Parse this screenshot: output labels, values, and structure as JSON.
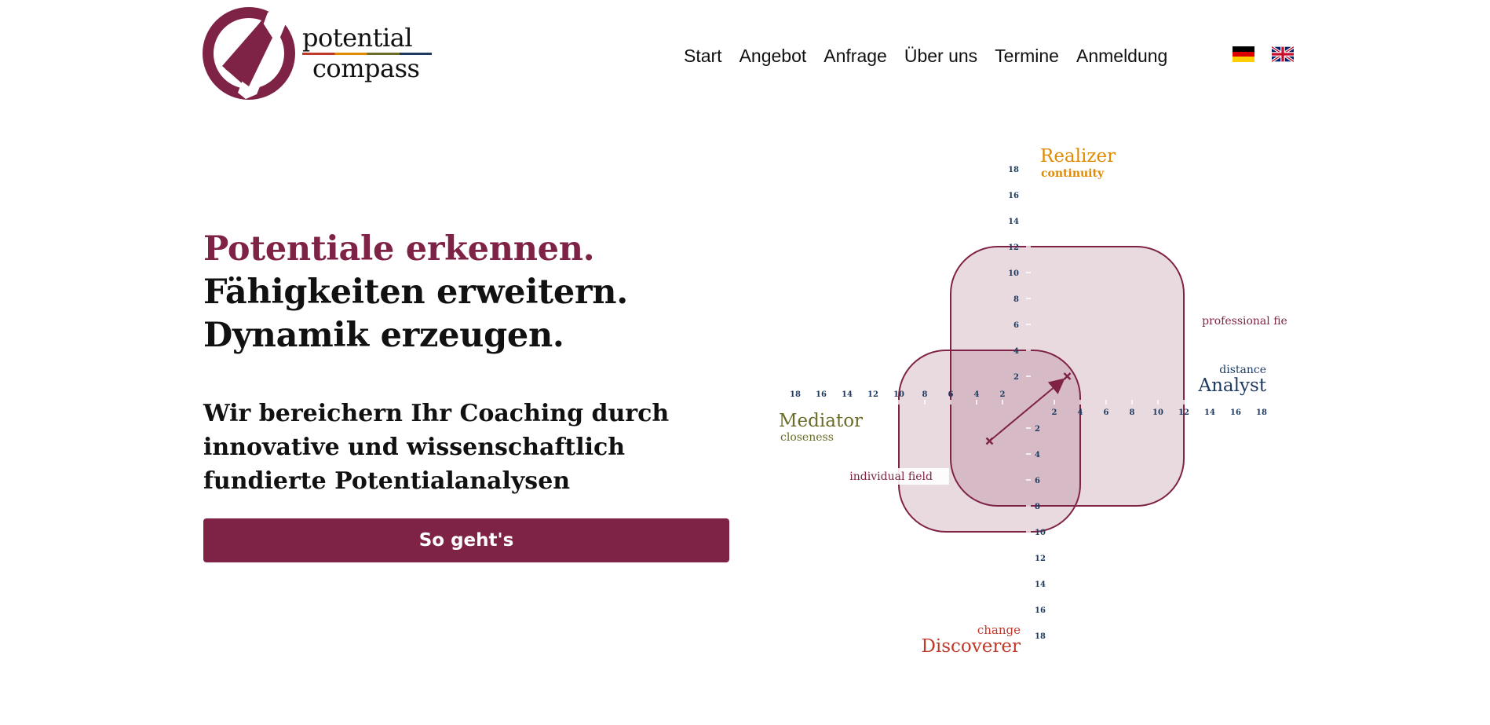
{
  "brand": {
    "line1": "potential",
    "line2": "compass",
    "colors": {
      "primary": "#7f2346"
    }
  },
  "nav": {
    "items": [
      "Start",
      "Angebot",
      "Anfrage",
      "Über uns",
      "Termine",
      "Anmeldung"
    ],
    "languages": [
      {
        "code": "de",
        "icon": "german-flag-icon"
      },
      {
        "code": "en",
        "icon": "uk-flag-icon"
      }
    ]
  },
  "hero": {
    "headline1": "Potentiale erkennen.",
    "headline2": "Fähigkeiten erweitern.",
    "headline3": "Dynamik erzeugen.",
    "subtext": "Wir bereichern Ihr Coaching durch innovative und wissenschaftlich fundierte Potentialanalysen",
    "cta_label": "So geht's"
  },
  "chart_data": {
    "type": "scatter",
    "axes": {
      "up": {
        "title": "Realizer",
        "subtitle": "continuity",
        "color": "#e08a00"
      },
      "right": {
        "title": "Analyst",
        "subtitle": "distance",
        "color": "#1e3a5f"
      },
      "down": {
        "title": "Discoverer",
        "subtitle": "change",
        "color": "#c0392b"
      },
      "left": {
        "title": "Mediator",
        "subtitle": "closeness",
        "color": "#6b6b2a"
      }
    },
    "ticks": [
      2,
      4,
      6,
      8,
      10,
      12,
      14,
      16,
      18
    ],
    "range": [
      -20,
      20
    ],
    "fields": [
      {
        "label": "professional field",
        "x_range": [
          -6,
          12
        ],
        "y_range": [
          -8,
          12
        ]
      },
      {
        "label": "individual field",
        "x_range": [
          -10,
          4
        ],
        "y_range": [
          -10,
          4
        ]
      }
    ],
    "points": [
      {
        "x": -3,
        "y": -3
      },
      {
        "x": 3,
        "y": 2
      }
    ],
    "arrow": {
      "from": [
        -3,
        -3
      ],
      "to": [
        3,
        2
      ]
    },
    "colors": {
      "field": "#7f2346"
    }
  }
}
